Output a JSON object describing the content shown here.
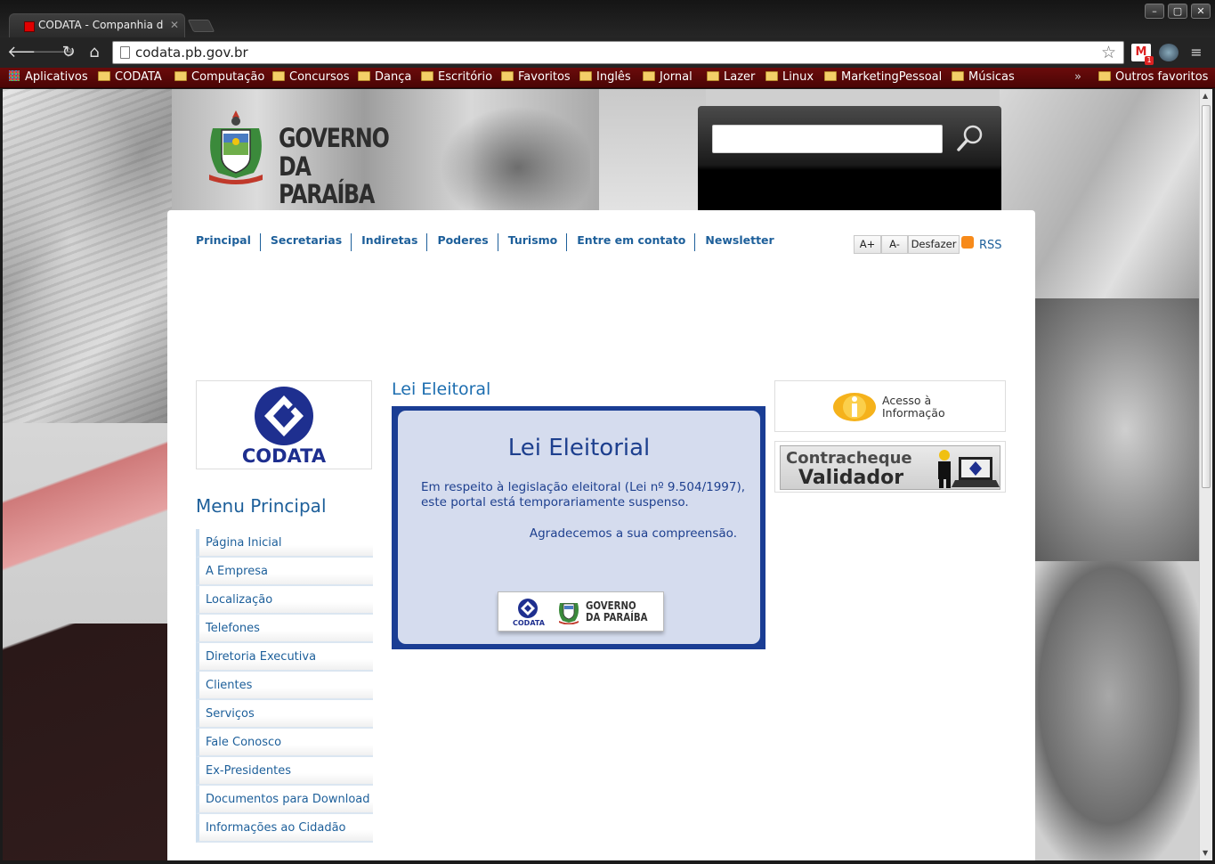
{
  "browser": {
    "tab_title": "CODATA - Companhia de Processamento de Dados",
    "url": "codata.pb.gov.br",
    "bookmarks": [
      {
        "label": "Aplicativos"
      },
      {
        "label": "CODATA"
      },
      {
        "label": "Computação"
      },
      {
        "label": "Concursos"
      },
      {
        "label": "Dança"
      },
      {
        "label": "Escritório"
      },
      {
        "label": "Favoritos"
      },
      {
        "label": "Inglês"
      },
      {
        "label": "Jornal"
      },
      {
        "label": "Lazer"
      },
      {
        "label": "Linux"
      },
      {
        "label": "MarketingPessoal"
      },
      {
        "label": "Músicas"
      }
    ],
    "overflow_chevron": "»",
    "other_bookmarks": "Outros favoritos",
    "gmail_badge": "1"
  },
  "header": {
    "logo_line1": "GOVERNO",
    "logo_line2": "DA PARAÍBA"
  },
  "topnav": {
    "items": [
      "Principal",
      "Secretarias",
      "Indiretas",
      "Poderes",
      "Turismo",
      "Entre em contato",
      "Newsletter"
    ]
  },
  "font_tools": {
    "increase": "A+",
    "decrease": "A-",
    "reset": "Desfazer",
    "rss": "RSS"
  },
  "sidebar": {
    "codata_logo_text": "CODATA",
    "menu_title": "Menu Principal",
    "items": [
      {
        "label": "Página Inicial"
      },
      {
        "label": "A Empresa"
      },
      {
        "label": "Localização"
      },
      {
        "label": "Telefones"
      },
      {
        "label": "Diretoria Executiva"
      },
      {
        "label": "Clientes"
      },
      {
        "label": "Serviços"
      },
      {
        "label": "Fale Conosco"
      },
      {
        "label": "Ex-Presidentes"
      },
      {
        "label": "Documentos para Download"
      },
      {
        "label": "Informações ao Cidadão"
      }
    ]
  },
  "main": {
    "title": "Lei Eleitoral",
    "notice": {
      "heading": "Lei Eleitorial",
      "paragraph": "Em respeito à legislação eleitoral (Lei nº 9.504/1997), este portal está temporariamente suspenso.",
      "thanks": "Agradecemos a sua compreensão.",
      "logo_codata": "CODATA",
      "logo_gov_line1": "GOVERNO",
      "logo_gov_line2": "DA PARAÍBA"
    }
  },
  "right": {
    "acesso_line1": "Acesso à",
    "acesso_line2": "Informação",
    "contra_line1": "Contracheque",
    "contra_line2": "Validador"
  },
  "colors": {
    "link_blue": "#1d5f9a",
    "notice_border": "#1a3d94",
    "notice_bg": "#d5dcee",
    "bookmark_bar": "#6b0b0b"
  }
}
